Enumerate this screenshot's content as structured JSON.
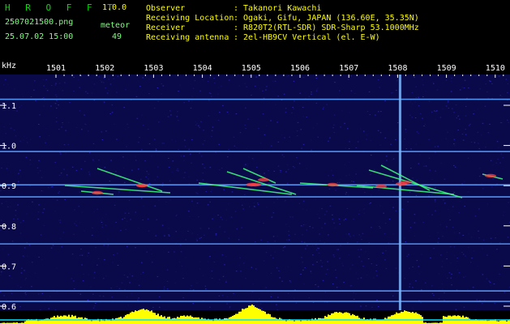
{
  "header": {
    "app_name": "H R O F F T",
    "version": "1.0.0",
    "filename": "2507021500.png",
    "datetime": "25.07.02 15:00",
    "meteor_label": "meteor",
    "meteor_count": "49",
    "info_labels": [
      "Observer",
      "Receiving Location",
      "Receiver",
      "Receiving antenna"
    ],
    "info_values": [
      ": Takanori Kawachi",
      ": Ogaki, Gifu, JAPAN (136.60E, 35.35N)",
      ": R820T2(RTL-SDR) SDR-Sharp 53.1000MHz",
      ": 2el-HB9CV Vertical (el. E-W)"
    ]
  },
  "chart_data": {
    "type": "heatmap",
    "ylabel": "kHz",
    "x_ticks": [
      "1501",
      "1502",
      "1503",
      "1504",
      "1505",
      "1506",
      "1507",
      "1508",
      "1509",
      "1510"
    ],
    "y_ticks": [
      "1.1",
      "1.0",
      "0.9",
      "0.8",
      "0.7",
      "0.6"
    ],
    "ylim": [
      0.58,
      1.18
    ],
    "horizontal_carriers_khz": [
      1.115,
      0.985,
      0.902,
      0.872,
      0.755,
      0.638,
      0.612
    ],
    "vertical_line_x": 1508.05,
    "colors": {
      "background": "#0a0a4a",
      "grid": "#ffffff",
      "carrier": "#5aa0ff",
      "meteor_head": "#ff4040",
      "meteor_tail": "#40ff80",
      "histogram": "#ffff00",
      "baseline": "#00e0ff"
    }
  }
}
